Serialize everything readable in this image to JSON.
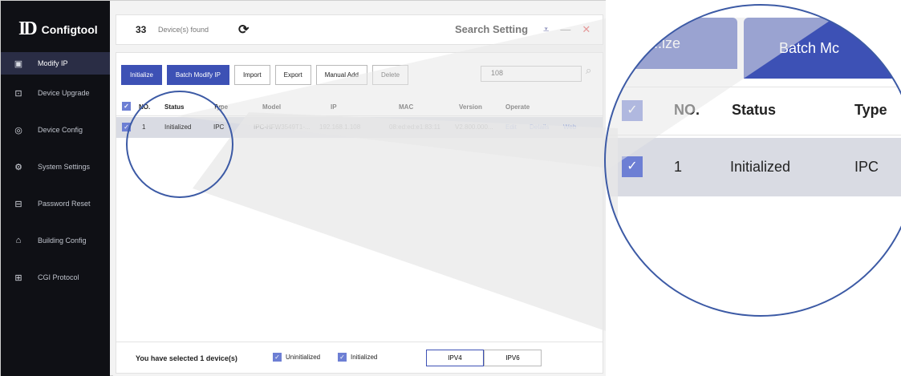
{
  "sidebar": {
    "logo_mark": "ID",
    "logo_text": "Configtool",
    "items": [
      {
        "label": "Modify IP",
        "icon": "monitor-icon",
        "active": true
      },
      {
        "label": "Device Upgrade",
        "icon": "upgrade-icon"
      },
      {
        "label": "Device Config",
        "icon": "config-icon"
      },
      {
        "label": "System Settings",
        "icon": "settings-icon"
      },
      {
        "label": "Password Reset",
        "icon": "lock-icon"
      },
      {
        "label": "Building Config",
        "icon": "building-icon"
      },
      {
        "label": "CGI Protocol",
        "icon": "grid-icon"
      }
    ]
  },
  "topbar": {
    "count": "33",
    "count_label": "Device(s) found",
    "search_setting": "Search Setting"
  },
  "toolbar": {
    "buttons": [
      "Initialize",
      "Batch Modify IP",
      "Import",
      "Export",
      "Manual Add",
      "Delete"
    ],
    "search_value": "108"
  },
  "table": {
    "headers": [
      "NO.",
      "Status",
      "Type",
      "Model",
      "IP",
      "MAC",
      "Version",
      "Operate"
    ],
    "rows": [
      {
        "no": "1",
        "status": "Initialized",
        "type": "IPC",
        "model": "IPC-HFW3549T1-...",
        "ip": "192.168.1.108",
        "mac": "08:ed:ed:e1:83:11",
        "version": "V2.800.000...",
        "actions": [
          "Edit",
          "Details",
          "Web"
        ]
      }
    ]
  },
  "footer": {
    "selected_text": "You have selected 1 device(s)",
    "checks": [
      "Uninitialized",
      "Initialized"
    ],
    "ipv_tabs": [
      "IPV4",
      "IPV6"
    ]
  },
  "zoom": {
    "tab_left": "..ize",
    "tab_right": "Batch Mc",
    "headers": [
      "NO.",
      "Status",
      "Type"
    ],
    "row": [
      "1",
      "Initialized",
      "IPC"
    ]
  },
  "colors": {
    "accent": "#3d51b5",
    "circle": "#3c5aa5",
    "selected_row": "#d9dbe3",
    "sidebar": "#0f1015"
  }
}
